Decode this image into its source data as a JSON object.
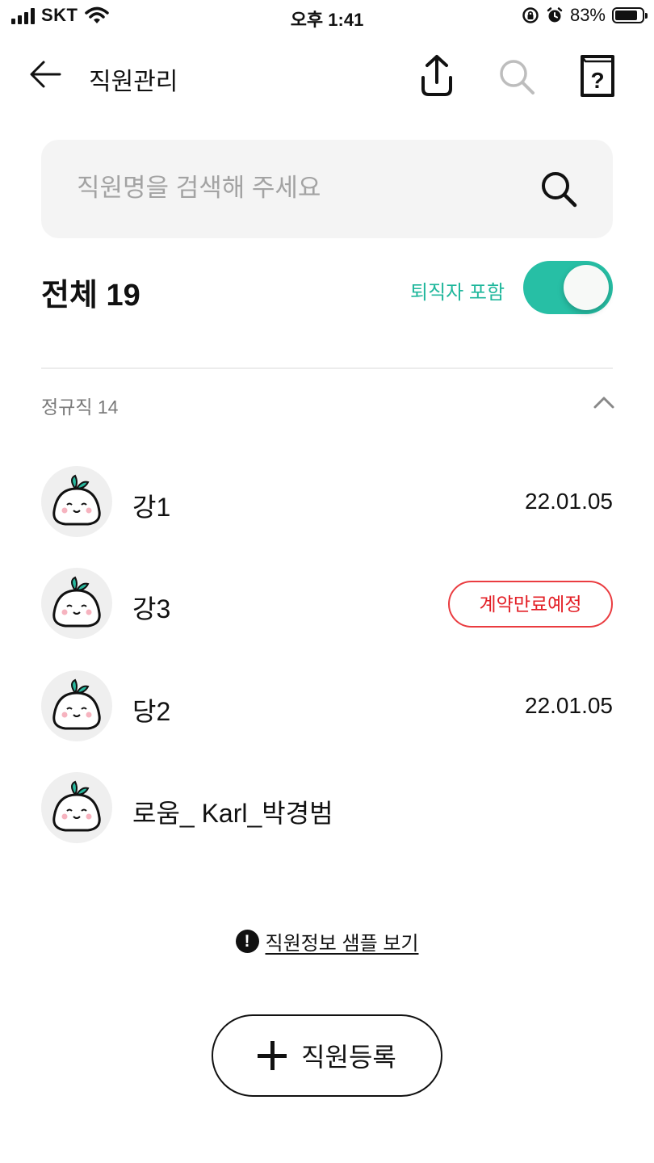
{
  "status_bar": {
    "carrier": "SKT",
    "time": "오후 1:41",
    "battery_pct": "83%",
    "battery_level": 0.83
  },
  "header": {
    "title": "직원관리",
    "icons": [
      "back-arrow-icon",
      "share-upload-icon",
      "search-icon",
      "help-book-icon"
    ]
  },
  "search": {
    "placeholder": "직원명을 검색해 주세요",
    "value": ""
  },
  "summary": {
    "total_label": "전체 19",
    "include_retired_label": "퇴직자 포함",
    "include_retired_on": true,
    "accent_color": "#27bfa5"
  },
  "group": {
    "label": "정규직 14",
    "expanded": true
  },
  "employees": [
    {
      "name": "강1",
      "date": "22.01.05",
      "badge": ""
    },
    {
      "name": "강3",
      "date": "",
      "badge": "계약만료예정"
    },
    {
      "name": "당2",
      "date": "22.01.05",
      "badge": ""
    },
    {
      "name": "로움_ Karl_박경범",
      "date": "",
      "badge": ""
    }
  ],
  "sample_link": {
    "label": "직원정보 샘플 보기",
    "icon": "!"
  },
  "register_button": {
    "label": "직원등록"
  },
  "colors": {
    "badge_red": "#e31f26",
    "search_bg": "#f4f4f4",
    "avatar_bg": "#efefef"
  }
}
